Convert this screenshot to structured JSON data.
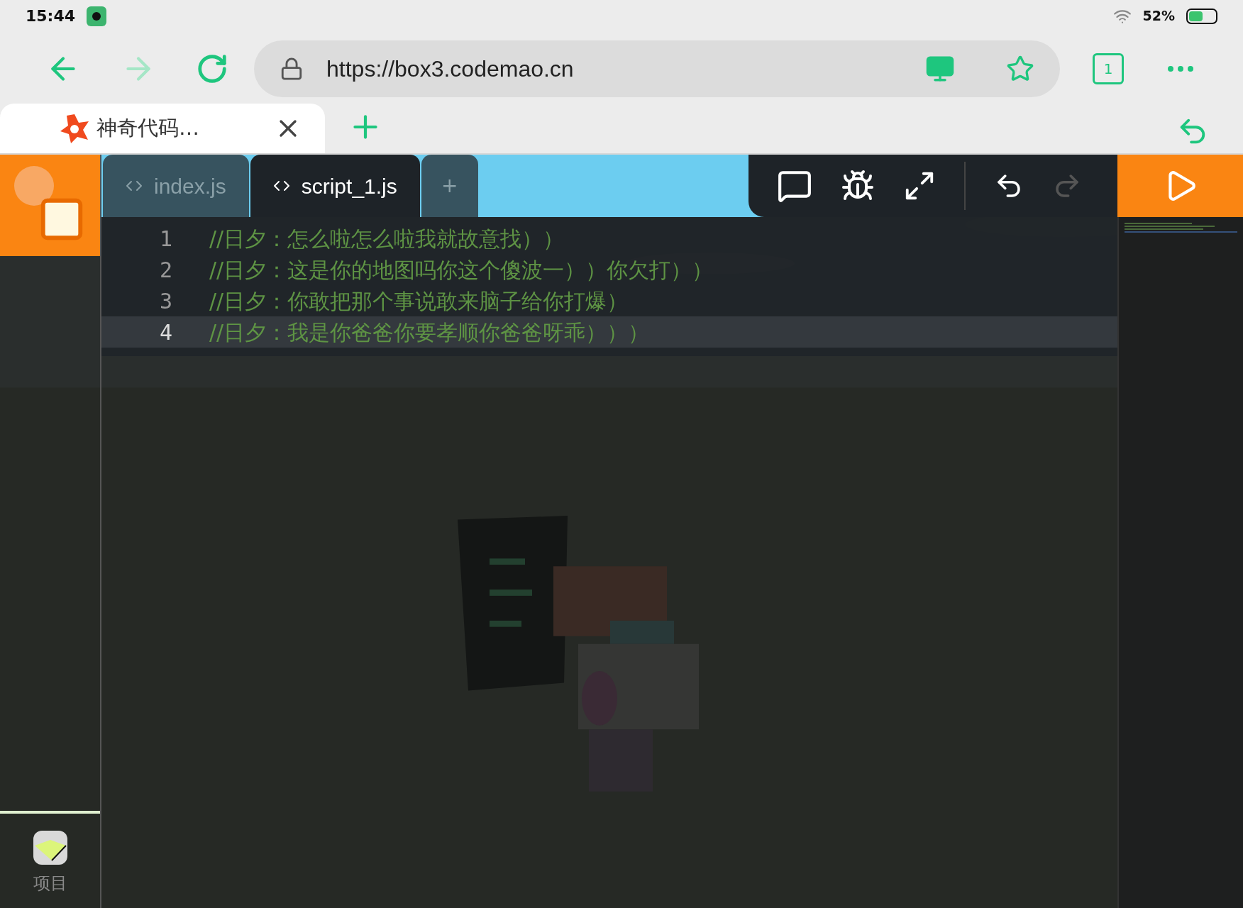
{
  "status_bar": {
    "time": "15:44",
    "battery": {
      "text": "52%",
      "level": 0.52
    }
  },
  "address_bar": {
    "url": "https://box3.codemao.cn"
  },
  "tab_count": "1",
  "browser_tabs": [
    {
      "title": "神奇代码…",
      "selected": true
    }
  ],
  "editor": {
    "file_tabs": [
      {
        "label": "index.js",
        "selected": false
      },
      {
        "label": "script_1.js",
        "selected": true
      }
    ],
    "add_tab": "+",
    "redo_disabled": true,
    "lines": [
      {
        "number": "1",
        "text": "//日夕：怎么啦怎么啦我就故意找））",
        "selected": false
      },
      {
        "number": "2",
        "text": "//日夕：这是你的地图吗你这个傻波一））你欠打））",
        "selected": false
      },
      {
        "number": "3",
        "text": "//日夕：你敢把那个事说敢来脑子给你打爆）",
        "selected": false
      },
      {
        "number": "4",
        "text": "//日夕：我是你爸爸你要孝顺你爸爸呀乖）））",
        "selected": true
      }
    ]
  },
  "sidebar": {
    "project_label": "项目"
  }
}
